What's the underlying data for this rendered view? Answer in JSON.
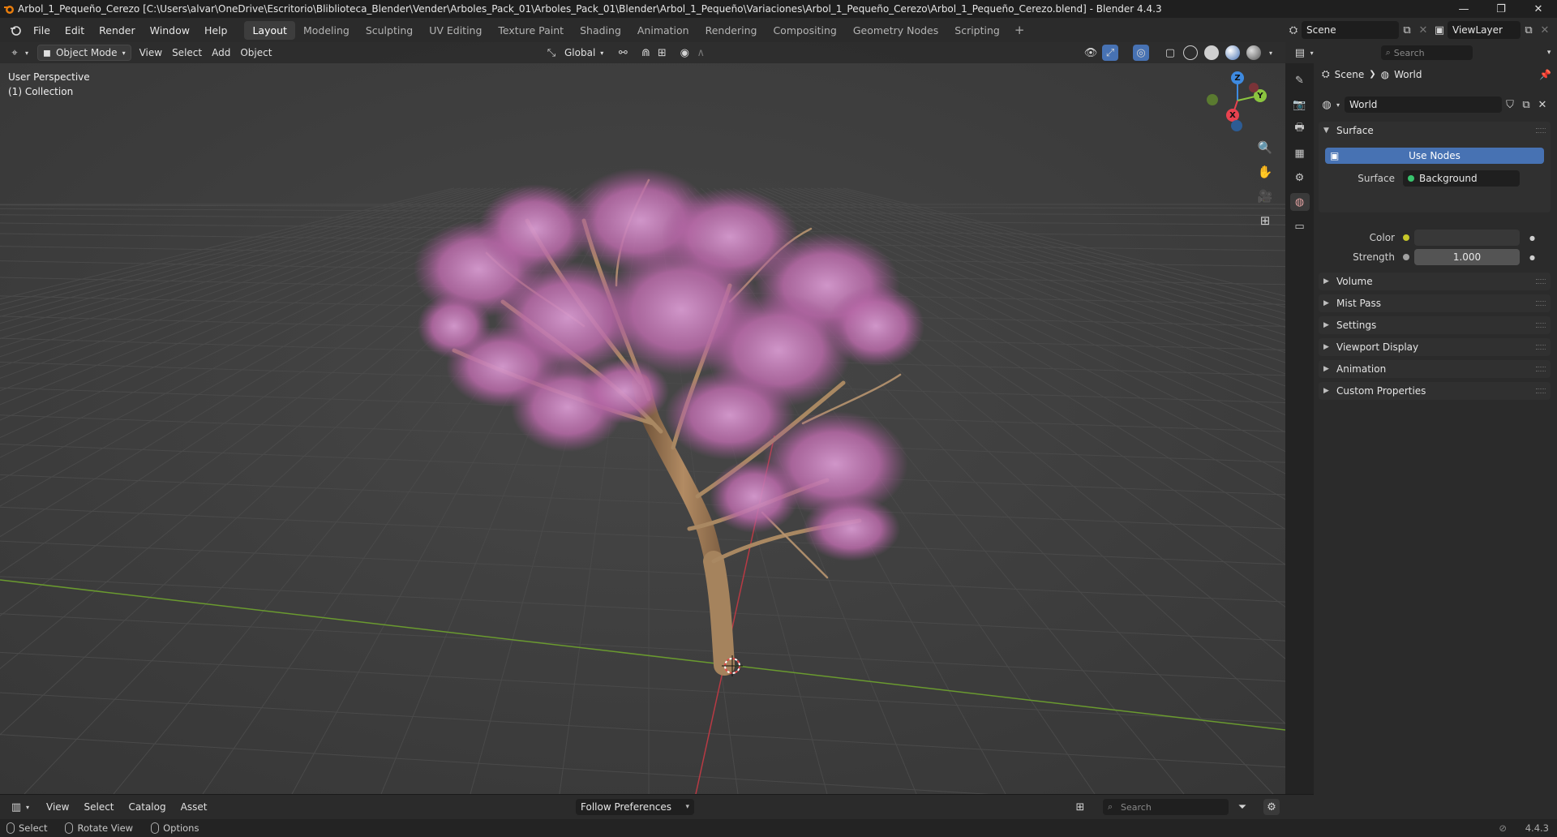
{
  "window": {
    "title": "Arbol_1_Pequeño_Cerezo [C:\\Users\\alvar\\OneDrive\\Escritorio\\Bliblioteca_Blender\\Vender\\Arboles_Pack_01\\Arboles_Pack_01\\Blender\\Arbol_1_Pequeño\\Variaciones\\Arbol_1_Pequeño_Cerezo\\Arbol_1_Pequeño_Cerezo.blend] - Blender 4.4.3",
    "minimize": "—",
    "maximize": "❐",
    "close": "✕"
  },
  "menu": [
    "File",
    "Edit",
    "Render",
    "Window",
    "Help"
  ],
  "workspaces": {
    "tabs": [
      "Layout",
      "Modeling",
      "Sculpting",
      "UV Editing",
      "Texture Paint",
      "Shading",
      "Animation",
      "Rendering",
      "Compositing",
      "Geometry Nodes",
      "Scripting"
    ],
    "active": "Layout",
    "add": "+"
  },
  "scene": {
    "name": "Scene",
    "view_layer": "ViewLayer"
  },
  "viewport": {
    "mode": "Object Mode",
    "menus": [
      "View",
      "Select",
      "Add",
      "Object"
    ],
    "orientation": "Global",
    "overlay_line1": "User Perspective",
    "overlay_line2": "(1) Collection",
    "gizmo_axes": {
      "x": "X",
      "y": "Y",
      "z": "Z"
    }
  },
  "properties": {
    "search_placeholder": "Search",
    "breadcrumb": [
      "Scene",
      "World"
    ],
    "world_name": "World",
    "surface_panel": {
      "title": "Surface",
      "use_nodes": "Use Nodes",
      "surface_label": "Surface",
      "surface_value": "Background",
      "color_label": "Color",
      "strength_label": "Strength",
      "strength_value": "1.000"
    },
    "collapsed_panels": [
      "Volume",
      "Mist Pass",
      "Settings",
      "Viewport Display",
      "Animation",
      "Custom Properties"
    ]
  },
  "asset_browser": {
    "menus": [
      "View",
      "Select",
      "Catalog",
      "Asset"
    ],
    "library": "Follow Preferences",
    "search_placeholder": "Search"
  },
  "statusbar": {
    "items": [
      "Select",
      "Rotate View",
      "Options"
    ],
    "version": "4.4.3"
  },
  "colors": {
    "accent": "#4772b3",
    "axis_x": "#e8424f",
    "axis_y": "#8bc53f",
    "axis_z": "#3e8ae0",
    "blossom": "#c77ab9",
    "trunk": "#9b7a58"
  }
}
